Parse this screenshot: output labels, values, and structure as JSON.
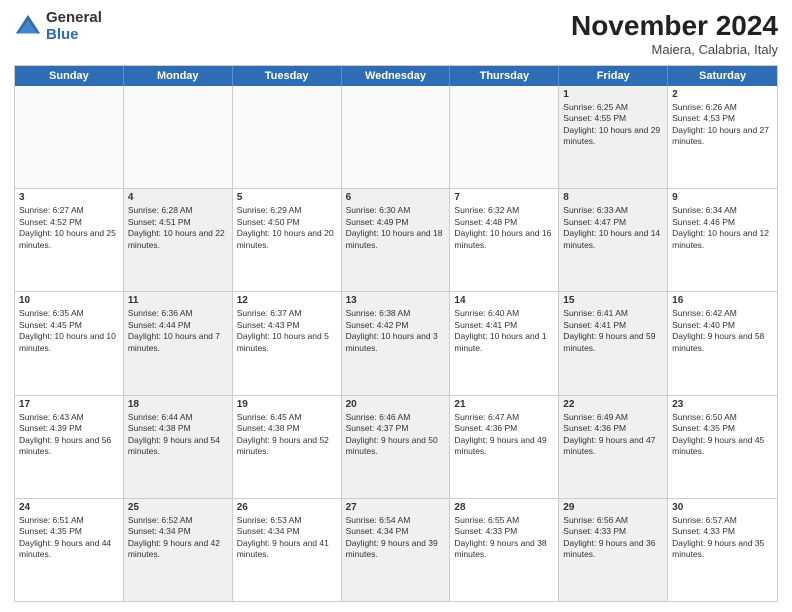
{
  "header": {
    "logo_line1": "General",
    "logo_line2": "Blue",
    "month": "November 2024",
    "location": "Maiera, Calabria, Italy"
  },
  "weekdays": [
    "Sunday",
    "Monday",
    "Tuesday",
    "Wednesday",
    "Thursday",
    "Friday",
    "Saturday"
  ],
  "rows": [
    [
      {
        "day": "",
        "text": "",
        "shaded": false,
        "empty": true
      },
      {
        "day": "",
        "text": "",
        "shaded": false,
        "empty": true
      },
      {
        "day": "",
        "text": "",
        "shaded": false,
        "empty": true
      },
      {
        "day": "",
        "text": "",
        "shaded": false,
        "empty": true
      },
      {
        "day": "",
        "text": "",
        "shaded": false,
        "empty": true
      },
      {
        "day": "1",
        "text": "Sunrise: 6:25 AM\nSunset: 4:55 PM\nDaylight: 10 hours and 29 minutes.",
        "shaded": true,
        "empty": false
      },
      {
        "day": "2",
        "text": "Sunrise: 6:26 AM\nSunset: 4:53 PM\nDaylight: 10 hours and 27 minutes.",
        "shaded": false,
        "empty": false
      }
    ],
    [
      {
        "day": "3",
        "text": "Sunrise: 6:27 AM\nSunset: 4:52 PM\nDaylight: 10 hours and 25 minutes.",
        "shaded": false,
        "empty": false
      },
      {
        "day": "4",
        "text": "Sunrise: 6:28 AM\nSunset: 4:51 PM\nDaylight: 10 hours and 22 minutes.",
        "shaded": true,
        "empty": false
      },
      {
        "day": "5",
        "text": "Sunrise: 6:29 AM\nSunset: 4:50 PM\nDaylight: 10 hours and 20 minutes.",
        "shaded": false,
        "empty": false
      },
      {
        "day": "6",
        "text": "Sunrise: 6:30 AM\nSunset: 4:49 PM\nDaylight: 10 hours and 18 minutes.",
        "shaded": true,
        "empty": false
      },
      {
        "day": "7",
        "text": "Sunrise: 6:32 AM\nSunset: 4:48 PM\nDaylight: 10 hours and 16 minutes.",
        "shaded": false,
        "empty": false
      },
      {
        "day": "8",
        "text": "Sunrise: 6:33 AM\nSunset: 4:47 PM\nDaylight: 10 hours and 14 minutes.",
        "shaded": true,
        "empty": false
      },
      {
        "day": "9",
        "text": "Sunrise: 6:34 AM\nSunset: 4:46 PM\nDaylight: 10 hours and 12 minutes.",
        "shaded": false,
        "empty": false
      }
    ],
    [
      {
        "day": "10",
        "text": "Sunrise: 6:35 AM\nSunset: 4:45 PM\nDaylight: 10 hours and 10 minutes.",
        "shaded": false,
        "empty": false
      },
      {
        "day": "11",
        "text": "Sunrise: 6:36 AM\nSunset: 4:44 PM\nDaylight: 10 hours and 7 minutes.",
        "shaded": true,
        "empty": false
      },
      {
        "day": "12",
        "text": "Sunrise: 6:37 AM\nSunset: 4:43 PM\nDaylight: 10 hours and 5 minutes.",
        "shaded": false,
        "empty": false
      },
      {
        "day": "13",
        "text": "Sunrise: 6:38 AM\nSunset: 4:42 PM\nDaylight: 10 hours and 3 minutes.",
        "shaded": true,
        "empty": false
      },
      {
        "day": "14",
        "text": "Sunrise: 6:40 AM\nSunset: 4:41 PM\nDaylight: 10 hours and 1 minute.",
        "shaded": false,
        "empty": false
      },
      {
        "day": "15",
        "text": "Sunrise: 6:41 AM\nSunset: 4:41 PM\nDaylight: 9 hours and 59 minutes.",
        "shaded": true,
        "empty": false
      },
      {
        "day": "16",
        "text": "Sunrise: 6:42 AM\nSunset: 4:40 PM\nDaylight: 9 hours and 58 minutes.",
        "shaded": false,
        "empty": false
      }
    ],
    [
      {
        "day": "17",
        "text": "Sunrise: 6:43 AM\nSunset: 4:39 PM\nDaylight: 9 hours and 56 minutes.",
        "shaded": false,
        "empty": false
      },
      {
        "day": "18",
        "text": "Sunrise: 6:44 AM\nSunset: 4:38 PM\nDaylight: 9 hours and 54 minutes.",
        "shaded": true,
        "empty": false
      },
      {
        "day": "19",
        "text": "Sunrise: 6:45 AM\nSunset: 4:38 PM\nDaylight: 9 hours and 52 minutes.",
        "shaded": false,
        "empty": false
      },
      {
        "day": "20",
        "text": "Sunrise: 6:46 AM\nSunset: 4:37 PM\nDaylight: 9 hours and 50 minutes.",
        "shaded": true,
        "empty": false
      },
      {
        "day": "21",
        "text": "Sunrise: 6:47 AM\nSunset: 4:36 PM\nDaylight: 9 hours and 49 minutes.",
        "shaded": false,
        "empty": false
      },
      {
        "day": "22",
        "text": "Sunrise: 6:49 AM\nSunset: 4:36 PM\nDaylight: 9 hours and 47 minutes.",
        "shaded": true,
        "empty": false
      },
      {
        "day": "23",
        "text": "Sunrise: 6:50 AM\nSunset: 4:35 PM\nDaylight: 9 hours and 45 minutes.",
        "shaded": false,
        "empty": false
      }
    ],
    [
      {
        "day": "24",
        "text": "Sunrise: 6:51 AM\nSunset: 4:35 PM\nDaylight: 9 hours and 44 minutes.",
        "shaded": false,
        "empty": false
      },
      {
        "day": "25",
        "text": "Sunrise: 6:52 AM\nSunset: 4:34 PM\nDaylight: 9 hours and 42 minutes.",
        "shaded": true,
        "empty": false
      },
      {
        "day": "26",
        "text": "Sunrise: 6:53 AM\nSunset: 4:34 PM\nDaylight: 9 hours and 41 minutes.",
        "shaded": false,
        "empty": false
      },
      {
        "day": "27",
        "text": "Sunrise: 6:54 AM\nSunset: 4:34 PM\nDaylight: 9 hours and 39 minutes.",
        "shaded": true,
        "empty": false
      },
      {
        "day": "28",
        "text": "Sunrise: 6:55 AM\nSunset: 4:33 PM\nDaylight: 9 hours and 38 minutes.",
        "shaded": false,
        "empty": false
      },
      {
        "day": "29",
        "text": "Sunrise: 6:56 AM\nSunset: 4:33 PM\nDaylight: 9 hours and 36 minutes.",
        "shaded": true,
        "empty": false
      },
      {
        "day": "30",
        "text": "Sunrise: 6:57 AM\nSunset: 4:33 PM\nDaylight: 9 hours and 35 minutes.",
        "shaded": false,
        "empty": false
      }
    ]
  ]
}
